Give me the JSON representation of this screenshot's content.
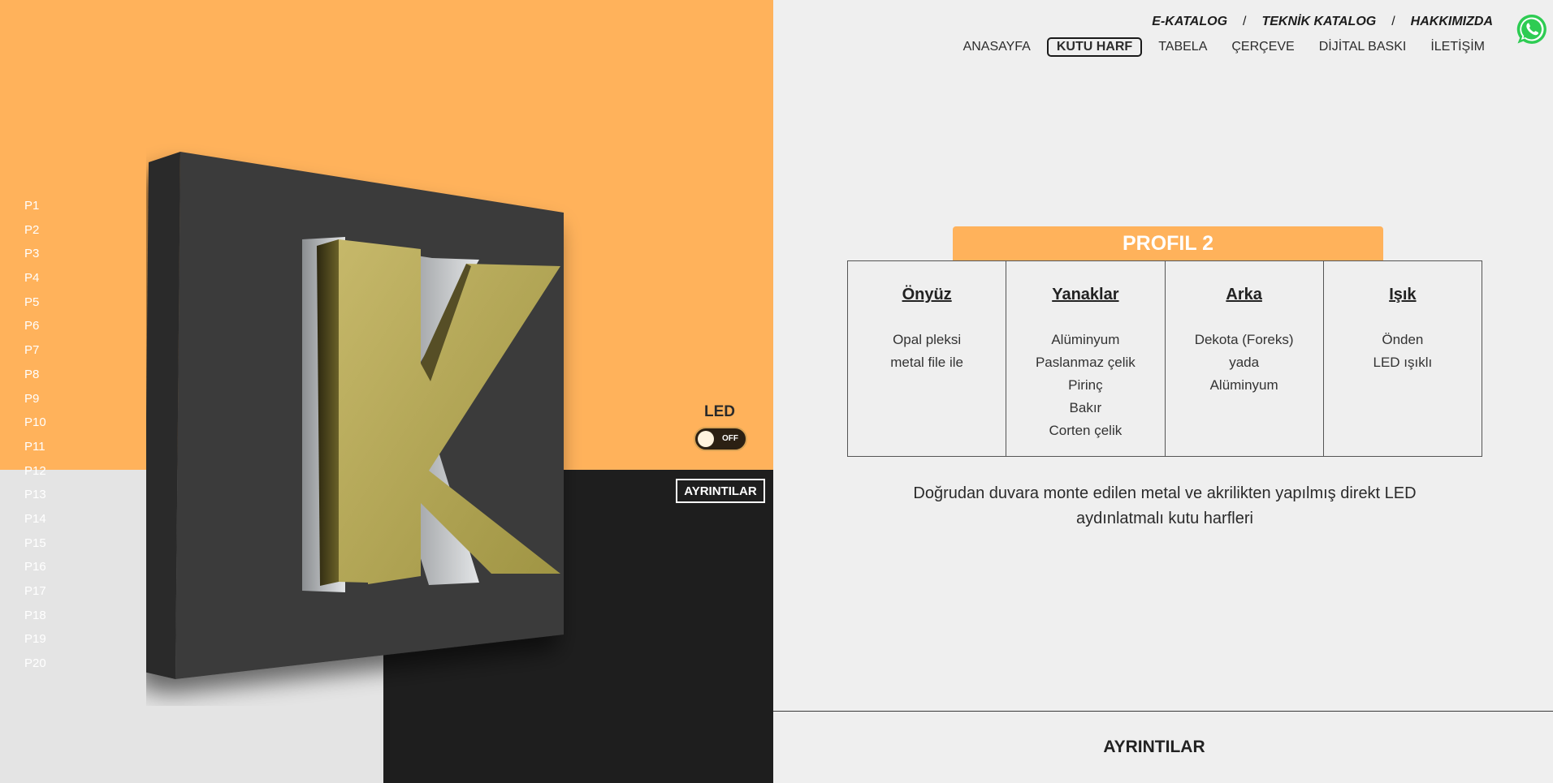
{
  "profiles": [
    "P1",
    "P2",
    "P3",
    "P4",
    "P5",
    "P6",
    "P7",
    "P8",
    "P9",
    "P10",
    "P11",
    "P12",
    "P13",
    "P14",
    "P15",
    "P16",
    "P17",
    "P18",
    "P19",
    "P20"
  ],
  "colors": {
    "accent_orange": "#ffb25b",
    "profile_text_on_orange": "#ffffff",
    "profile_text_on_grey": "#ffffff"
  },
  "product": {
    "letter": "K",
    "led_label": "LED",
    "led_state": "OFF",
    "details_button": "AYRINTILAR"
  },
  "header": {
    "top_links": [
      "E-KATALOG",
      "TEKNİK KATALOG",
      "HAKKIMIZDA"
    ],
    "separator": "/",
    "nav": [
      "ANASAYFA",
      "KUTU HARF",
      "TABELA",
      "ÇERÇEVE",
      "DİJİTAL BASKI",
      "İLETİŞİM"
    ],
    "nav_active": "KUTU HARF",
    "whatsapp_icon": "whatsapp-icon"
  },
  "profile_card": {
    "title": "PROFIL 2",
    "columns": [
      {
        "head": "Önyüz",
        "lines": [
          "Opal pleksi",
          "metal file ile"
        ]
      },
      {
        "head": "Yanaklar",
        "lines": [
          "Alüminyum",
          "Paslanmaz çelik",
          "Pirinç",
          "Bakır",
          "Corten çelik"
        ]
      },
      {
        "head": "Arka",
        "lines": [
          "Dekota (Foreks)",
          "yada",
          "Alüminyum"
        ]
      },
      {
        "head": "Işık",
        "lines": [
          "Önden",
          "LED ışıklı"
        ]
      }
    ],
    "description": "Doğrudan duvara monte edilen metal ve akrilikten yapılmış direkt LED aydınlatmalı kutu harfleri",
    "details_button": "AYRINTILAR"
  }
}
